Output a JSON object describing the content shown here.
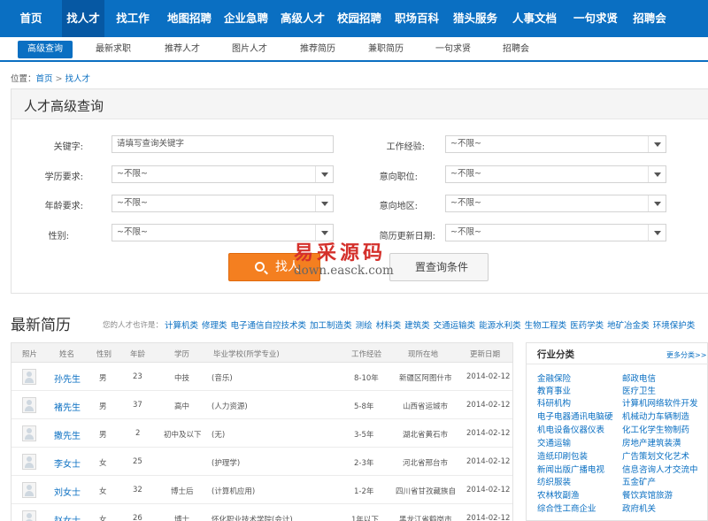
{
  "nav": {
    "items": [
      {
        "label": "首页",
        "active": false
      },
      {
        "label": "找人才",
        "active": true
      },
      {
        "label": "找工作",
        "active": false
      },
      {
        "label": "地图招聘",
        "active": false
      },
      {
        "label": "企业急聘",
        "active": false
      },
      {
        "label": "高级人才",
        "active": false
      },
      {
        "label": "校园招聘",
        "active": false
      },
      {
        "label": "职场百科",
        "active": false
      },
      {
        "label": "猎头服务",
        "active": false
      },
      {
        "label": "人事文档",
        "active": false
      },
      {
        "label": "一句求贤",
        "active": false
      },
      {
        "label": "招聘会",
        "active": false
      }
    ]
  },
  "subnav": {
    "items": [
      {
        "label": "高级查询",
        "active": true
      },
      {
        "label": "最新求职",
        "active": false
      },
      {
        "label": "推荐人才",
        "active": false
      },
      {
        "label": "图片人才",
        "active": false
      },
      {
        "label": "推荐简历",
        "active": false
      },
      {
        "label": "兼职简历",
        "active": false
      },
      {
        "label": "一句求贤",
        "active": false
      },
      {
        "label": "招聘会",
        "active": false
      }
    ]
  },
  "breadcrumb": {
    "prefix": "位置：",
    "home": "首页",
    "separator": ">",
    "current": "找人才"
  },
  "search": {
    "title": "人才高级查询",
    "keyword_label": "关键字:",
    "keyword_value": "请填写查询关键字",
    "experience_label": "工作经验:",
    "experience_value": "~不限~",
    "education_label": "学历要求:",
    "education_value": "~不限~",
    "position_label": "意向职位:",
    "position_value": "~不限~",
    "age_label": "年龄要求:",
    "age_value": "~不限~",
    "region_label": "意向地区:",
    "region_value": "~不限~",
    "gender_label": "性别:",
    "gender_value": "~不限~",
    "updated_label": "简历更新日期:",
    "updated_value": "~不限~",
    "search_button": "找人",
    "reset_button": "置查询条件"
  },
  "watermark": {
    "cn": "易采源码",
    "url": "down.easck.com"
  },
  "latest": {
    "title": "最新简历",
    "hint": "您的人才也许是：",
    "categories": [
      "计算机类",
      "修理类",
      "电子通信自控技术类",
      "加工制造类",
      "测绘",
      "材料类",
      "建筑类",
      "交通运输类",
      "能源水利类",
      "生物工程类",
      "医药学类",
      "地矿冶金类",
      "环境保护类"
    ],
    "columns": [
      "照片",
      "姓名",
      "性别",
      "年龄",
      "学历",
      "毕业学校(所学专业)",
      "工作经验",
      "现所在地",
      "更新日期"
    ],
    "rows": [
      {
        "name": "孙先生",
        "gender": "男",
        "age": "23",
        "edu": "中技",
        "school": "(音乐)",
        "exp": "8-10年",
        "loc": "新疆区阿图什市",
        "date": "2014-02-12"
      },
      {
        "name": "褚先生",
        "gender": "男",
        "age": "37",
        "edu": "高中",
        "school": "(人力资源)",
        "exp": "5-8年",
        "loc": "山西省运城市",
        "date": "2014-02-12"
      },
      {
        "name": "撒先生",
        "gender": "男",
        "age": "2",
        "edu": "初中及以下",
        "school": "(无)",
        "exp": "3-5年",
        "loc": "湖北省黄石市",
        "date": "2014-02-12"
      },
      {
        "name": "李女士",
        "gender": "女",
        "age": "25",
        "edu": "",
        "school": "(护理学)",
        "exp": "2-3年",
        "loc": "河北省邢台市",
        "date": "2014-02-12"
      },
      {
        "name": "刘女士",
        "gender": "女",
        "age": "32",
        "edu": "博士后",
        "school": "(计算机应用)",
        "exp": "1-2年",
        "loc": "四川省甘孜藏族自",
        "date": "2014-02-12"
      },
      {
        "name": "赵女士",
        "gender": "女",
        "age": "26",
        "edu": "博士",
        "school": "怀化职业技术学院(会计)",
        "exp": "1年以下",
        "loc": "黑龙江省鹤岗市",
        "date": "2014-02-12"
      }
    ]
  },
  "industry": {
    "title": "行业分类",
    "more": "更多分类>>",
    "items": [
      "金融保险",
      "邮政电信",
      "教育事业",
      "医疗卫生",
      "科研机构",
      "计算机网络软件开发",
      "电子电器通讯电脑硬",
      "机械动力车辆制造",
      "机电设备仪器仪表",
      "化工化学生物制药",
      "交通运输",
      "房地产建筑装潢",
      "造纸印刷包装",
      "广告策划文化艺术",
      "新闻出版广播电视",
      "信息咨询人才交流中",
      "纺织服装",
      "五金矿产",
      "农林牧副渔",
      "餐饮宾馆旅游",
      "综合性工商企业",
      "政府机关"
    ]
  }
}
